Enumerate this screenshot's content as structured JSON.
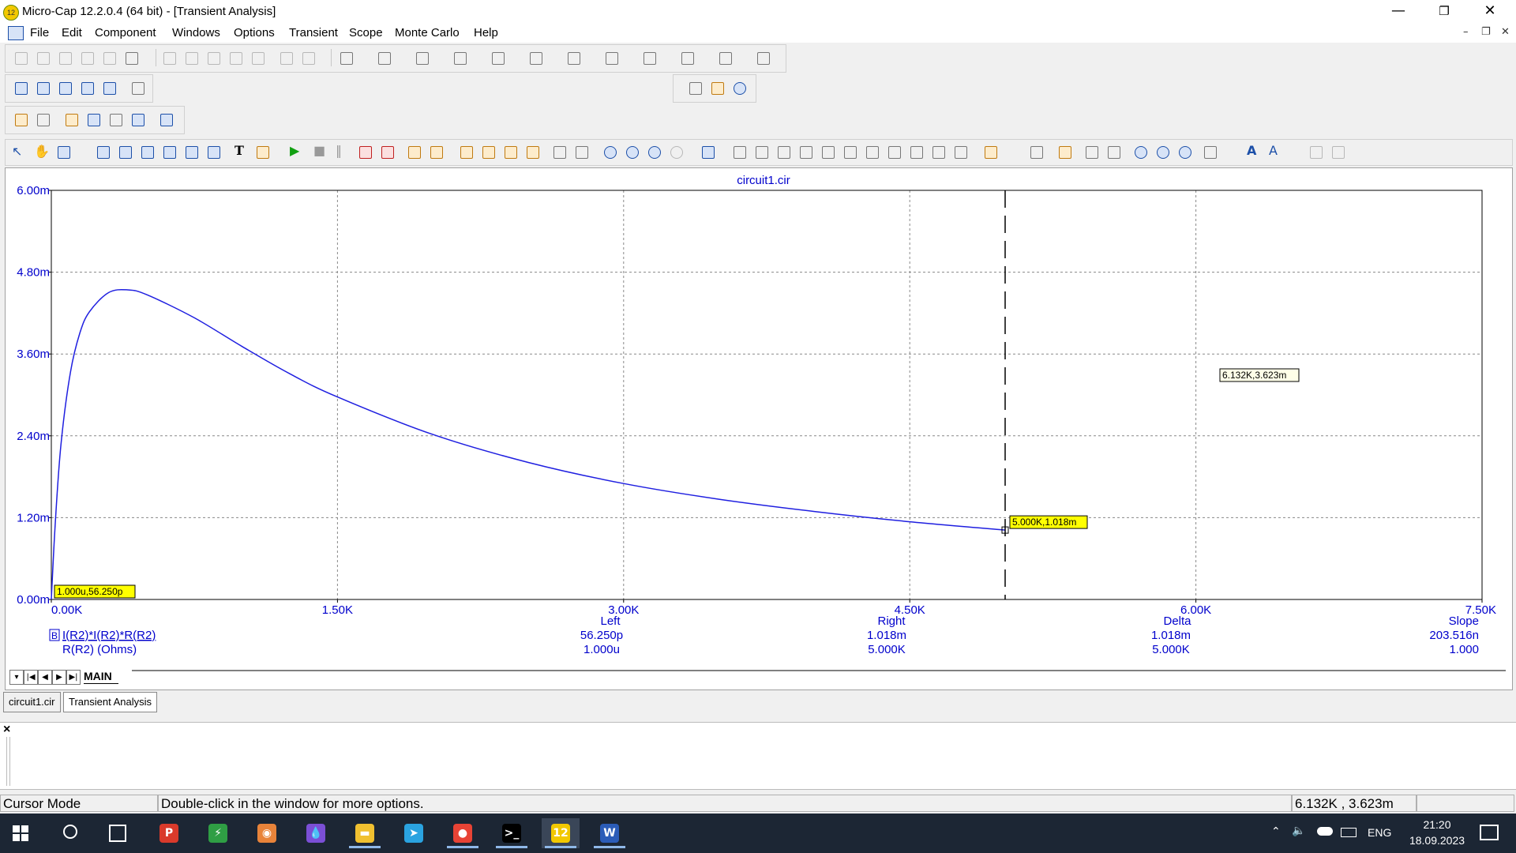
{
  "window": {
    "title": "Micro-Cap 12.2.0.4 (64 bit) - [Transient Analysis]",
    "app_icon_label": "12",
    "minimize": "—",
    "maximize": "❐",
    "close": "✕"
  },
  "menu": [
    "File",
    "Edit",
    "Component",
    "Windows",
    "Options",
    "Transient",
    "Scope",
    "Monte Carlo",
    "Help"
  ],
  "mdi_controls": [
    "–",
    "❐",
    "✕"
  ],
  "plot": {
    "title": "circuit1.cir",
    "y_ticks": [
      "6.00m",
      "4.80m",
      "3.60m",
      "2.40m",
      "1.20m",
      "0.00m"
    ],
    "x_ticks": [
      "0.00K",
      "1.50K",
      "3.00K",
      "4.50K",
      "6.00K",
      "7.50K"
    ],
    "trace_label": "I(R2)*I(R2)*R(R2)",
    "trace_marker": "B",
    "x_variable": "R(R2) (Ohms)",
    "cursor_left_label": "1.000u,56.250p",
    "cursor_right_label": "5.000K,1.018m",
    "mouse_label": "6.132K,3.623m",
    "readout": {
      "left": {
        "header": "Left",
        "y": "56.250p",
        "x": "1.000u"
      },
      "right": {
        "header": "Right",
        "y": "1.018m",
        "x": "5.000K"
      },
      "delta": {
        "header": "Delta",
        "y": "1.018m",
        "x": "5.000K"
      },
      "slope": {
        "header": "Slope",
        "y": "203.516n",
        "x": "1.000"
      }
    },
    "trace_color": "#1f1fe0",
    "axis_color": "#0000cc",
    "tag_color": "#ffff00"
  },
  "chart_data": {
    "type": "line",
    "title": "circuit1.cir",
    "xlabel": "R(R2) (Ohms)",
    "ylabel": "",
    "xlim": [
      0,
      7500
    ],
    "ylim": [
      0,
      0.006
    ],
    "x_tick_labels": [
      "0.00K",
      "1.50K",
      "3.00K",
      "4.50K",
      "6.00K",
      "7.50K"
    ],
    "y_tick_labels": [
      "0.00m",
      "1.20m",
      "2.40m",
      "3.60m",
      "4.80m",
      "6.00m"
    ],
    "grid": true,
    "series": [
      {
        "name": "I(R2)*I(R2)*R(R2)",
        "x": [
          0,
          20,
          50,
          100,
          150,
          200,
          300,
          400,
          500,
          750,
          1000,
          1250,
          1500,
          2000,
          2500,
          3000,
          3500,
          4000,
          4500,
          5000
        ],
        "y": [
          0,
          0.00108,
          0.00226,
          0.00333,
          0.00391,
          0.00422,
          0.0045,
          0.00454,
          0.00447,
          0.00413,
          0.00371,
          0.00331,
          0.00297,
          0.00242,
          0.00201,
          0.0017,
          0.00147,
          0.00129,
          0.00114,
          0.001018
        ]
      }
    ],
    "cursors": [
      {
        "name": "Left",
        "x": 1e-06,
        "y": 5.625e-11
      },
      {
        "name": "Right",
        "x": 5000,
        "y": 0.001018
      }
    ]
  },
  "sheet_tabs": {
    "nav": [
      "▾",
      "|◀",
      "◀",
      "▶",
      "▶|"
    ],
    "active": "MAIN"
  },
  "doc_tabs": [
    "circuit1.cir",
    "Transient Analysis"
  ],
  "output_pane": {
    "close": "×"
  },
  "status": {
    "mode": "Cursor Mode",
    "hint": "Double-click in the window for more options.",
    "coords": "6.132K , 3.623m"
  },
  "taskbar": {
    "apps": [
      {
        "name": "P",
        "color": "#d93a2b"
      },
      {
        "name": "⚡",
        "color": "#2f9e44"
      },
      {
        "name": "◉",
        "color": "#e8833a"
      },
      {
        "name": "💧",
        "color": "#7b4fd6"
      },
      {
        "name": "▬",
        "color": "#f0c030"
      },
      {
        "name": "➤",
        "color": "#2aa3e0"
      },
      {
        "name": "●",
        "color": "#e84335"
      },
      {
        "name": ">_",
        "color": "#000000"
      },
      {
        "name": "12",
        "color": "#f2c800"
      },
      {
        "name": "W",
        "color": "#2b5cb8"
      }
    ],
    "lang": "ENG",
    "time": "21:20",
    "date": "18.09.2023"
  }
}
